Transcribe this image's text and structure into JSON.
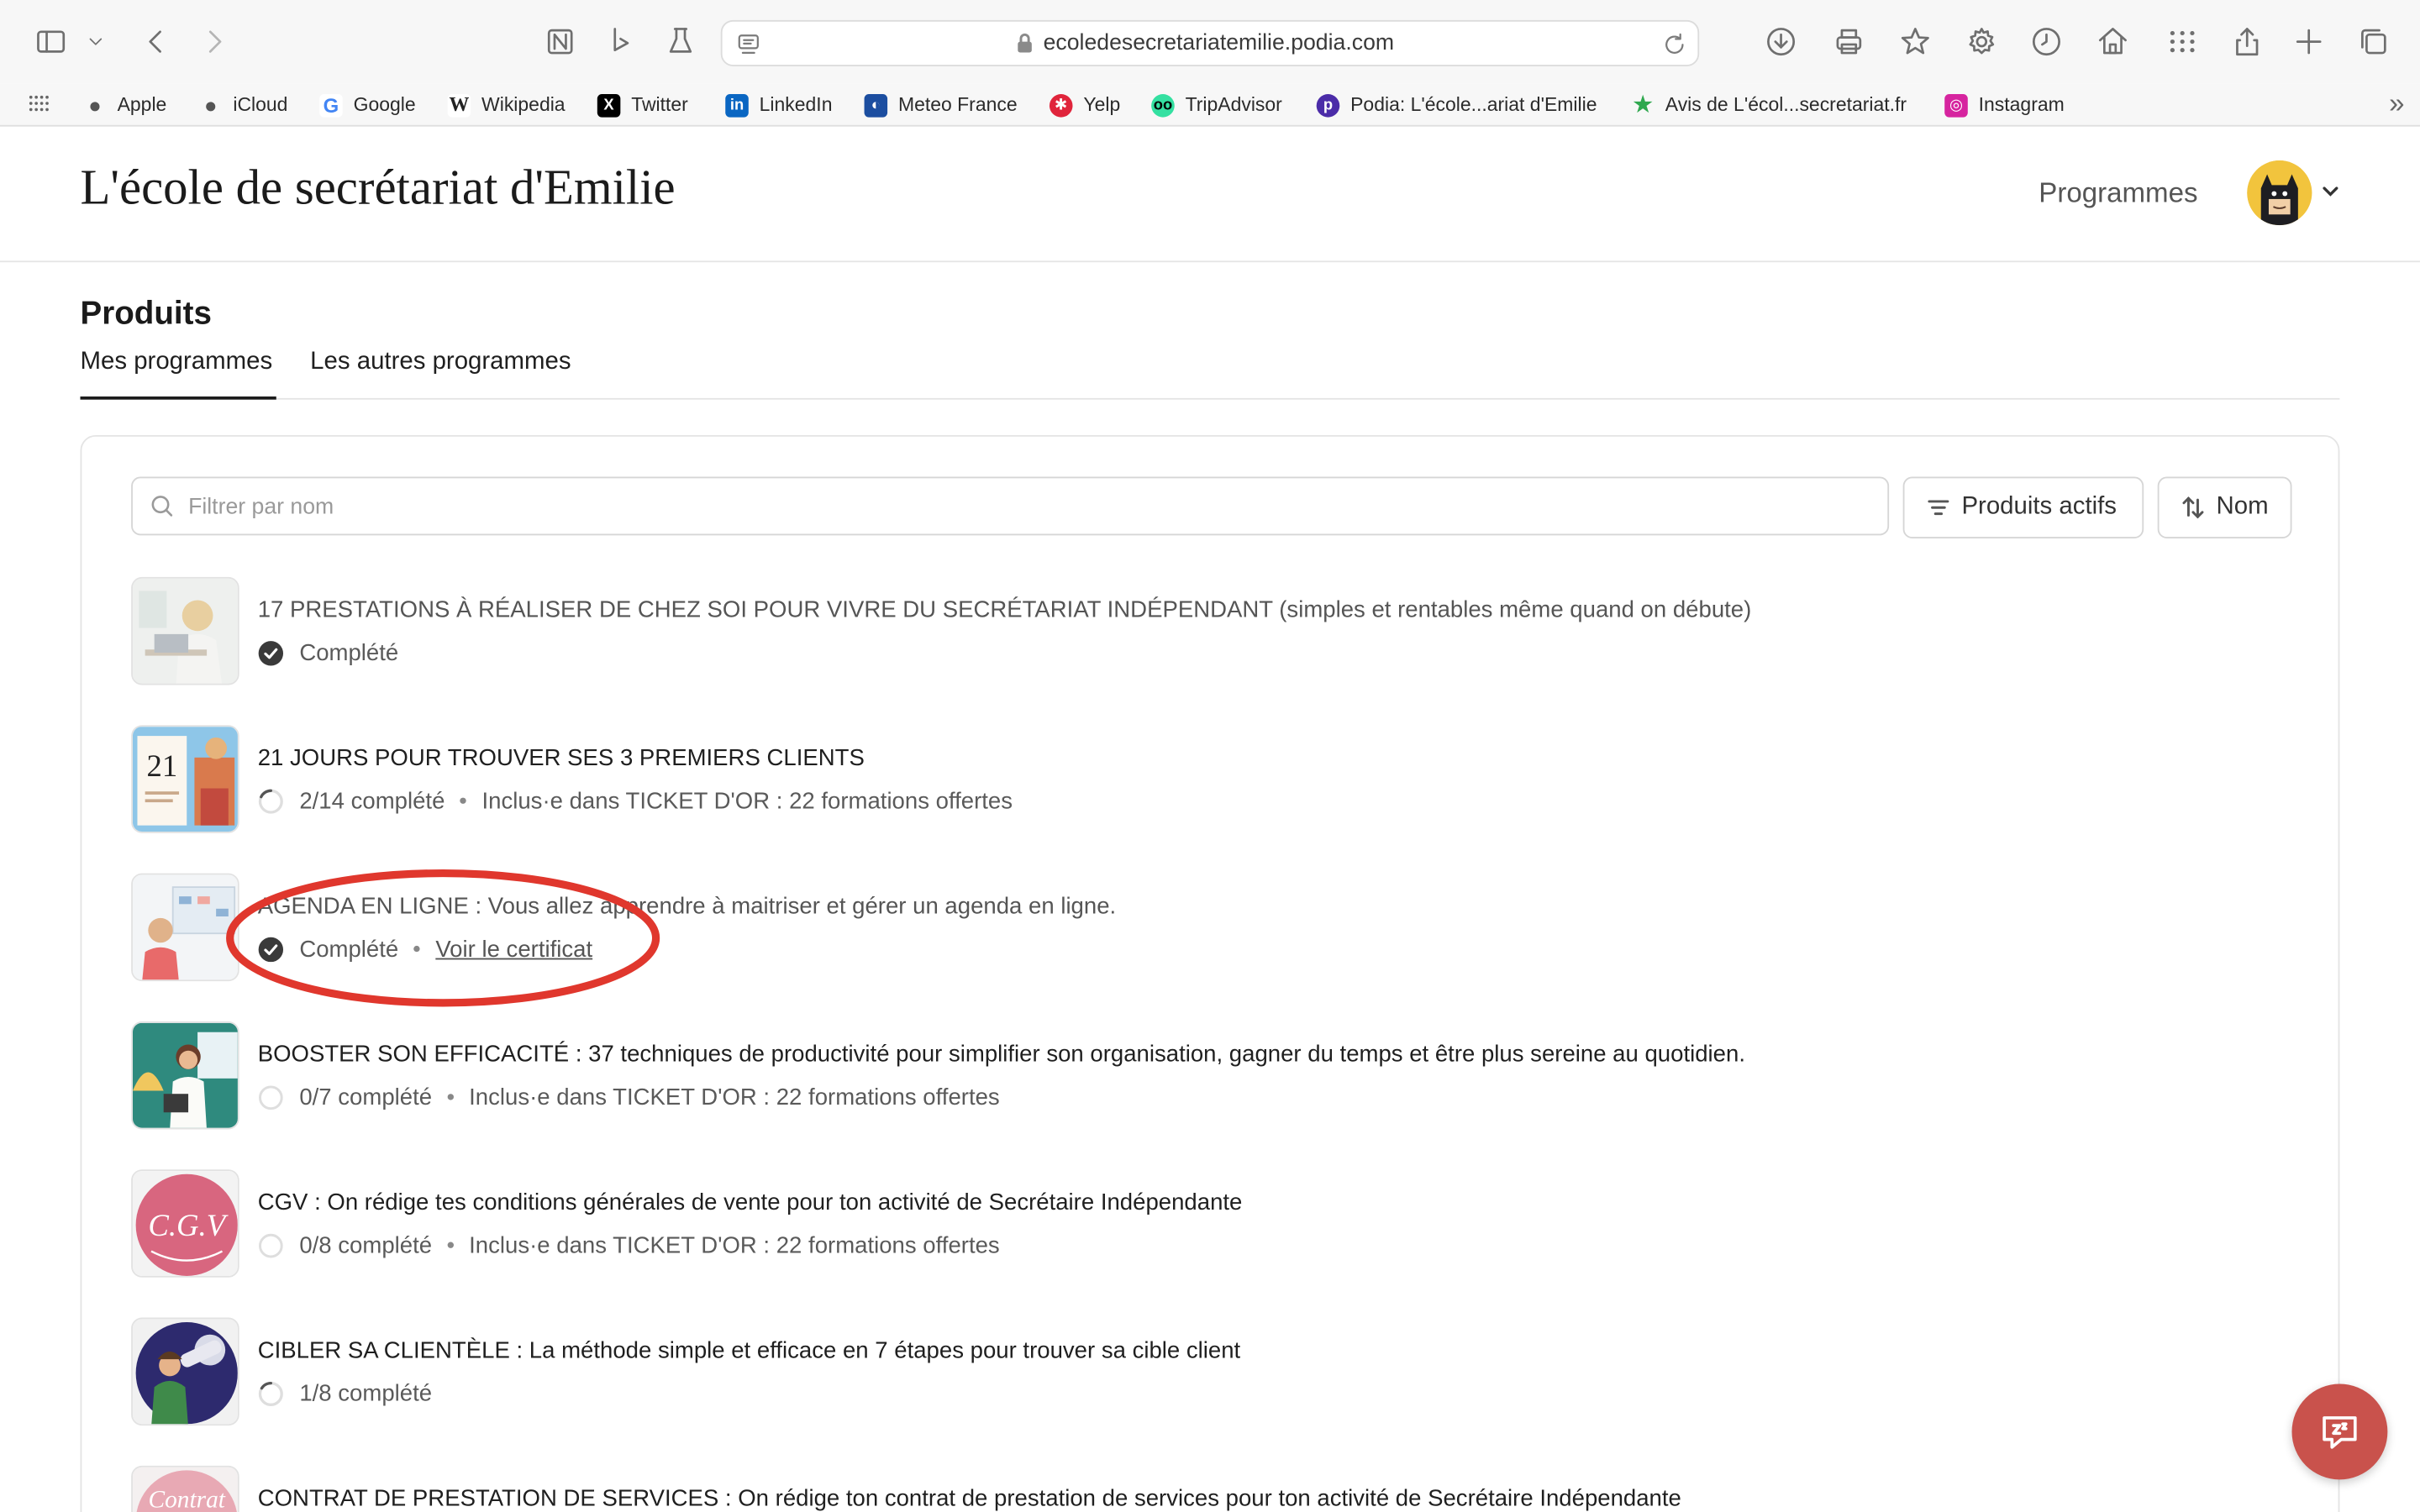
{
  "browser": {
    "url": "ecoledesecretariatemilie.podia.com",
    "bookmarks": [
      {
        "label": "Apple",
        "icon": "apple-icon",
        "color": "#555555"
      },
      {
        "label": "iCloud",
        "icon": "apple-icon",
        "color": "#555555"
      },
      {
        "label": "Google",
        "icon": "google-icon",
        "color": "#4285f4"
      },
      {
        "label": "Wikipedia",
        "icon": "wikipedia-icon",
        "color": "#222222"
      },
      {
        "label": "Twitter",
        "icon": "x-icon",
        "color": "#000000"
      },
      {
        "label": "LinkedIn",
        "icon": "linkedin-icon",
        "color": "#0a66c2"
      },
      {
        "label": "Meteo France",
        "icon": "meteo-france-icon",
        "color": "#1c4ea0"
      },
      {
        "label": "Yelp",
        "icon": "yelp-icon",
        "color": "#e0243b"
      },
      {
        "label": "TripAdvisor",
        "icon": "tripadvisor-icon",
        "color": "#34e0a1"
      },
      {
        "label": "Podia: L'école...ariat d'Emilie",
        "icon": "podia-icon",
        "color": "#4b2ca8"
      },
      {
        "label": "Avis de L'écol...secretariat.fr",
        "icon": "star-icon",
        "color": "#2fa84f"
      },
      {
        "label": "Instagram",
        "icon": "instagram-icon",
        "color": "#d6249f"
      }
    ]
  },
  "site": {
    "title": "L'école de secrétariat d'Emilie",
    "nav": {
      "programmes": "Programmes"
    }
  },
  "products": {
    "heading": "Produits",
    "tabs": [
      {
        "label": "Mes programmes",
        "active": true
      },
      {
        "label": "Les autres programmes",
        "active": false
      }
    ],
    "filter_placeholder": "Filtrer par nom",
    "filter_value": "",
    "status_button": "Produits actifs",
    "sort_button": "Nom",
    "items": [
      {
        "title": "17 PRESTATIONS À RÉALISER DE CHEZ SOI POUR VIVRE DU SECRÉTARIAT INDÉPENDANT (simples et rentables même quand on débute)",
        "status": "Complété",
        "status_type": "complete",
        "progress": 1.0,
        "included": "",
        "certificate": ""
      },
      {
        "title": "21 JOURS POUR TROUVER SES 3 PREMIERS CLIENTS",
        "status": "2/14 complété",
        "status_type": "partial",
        "progress": 0.14,
        "included": "Inclus·e dans TICKET D'OR : 22 formations offertes",
        "certificate": "",
        "thumb_text": "21"
      },
      {
        "title": "AGENDA EN LIGNE : Vous allez apprendre à maitriser et gérer un agenda en ligne.",
        "status": "Complété",
        "status_type": "complete",
        "progress": 1.0,
        "included": "",
        "certificate": "Voir le certificat"
      },
      {
        "title": "BOOSTER SON EFFICACITÉ : 37 techniques de productivité pour simplifier son organisation, gagner du temps et être plus sereine au quotidien.",
        "status": "0/7 complété",
        "status_type": "none",
        "progress": 0.0,
        "included": "Inclus·e dans TICKET D'OR : 22 formations offertes",
        "certificate": ""
      },
      {
        "title": "CGV : On rédige tes conditions générales de vente pour ton activité de Secrétaire Indépendante",
        "status": "0/8 complété",
        "status_type": "none",
        "progress": 0.0,
        "included": "Inclus·e dans TICKET D'OR : 22 formations offertes",
        "certificate": "",
        "thumb_text": "C.G.V"
      },
      {
        "title": "CIBLER SA CLIENTÈLE : La méthode simple et efficace en 7 étapes pour trouver sa cible client",
        "status": "1/8 complété",
        "status_type": "partial",
        "progress": 0.125,
        "included": "",
        "certificate": ""
      },
      {
        "title": "CONTRAT DE PRESTATION DE SERVICES : On rédige ton contrat de prestation de services pour ton activité de Secrétaire Indépendante",
        "status": "",
        "status_type": "none",
        "progress": 0.0,
        "included": "",
        "certificate": "",
        "thumb_text": "Contrat"
      }
    ]
  }
}
